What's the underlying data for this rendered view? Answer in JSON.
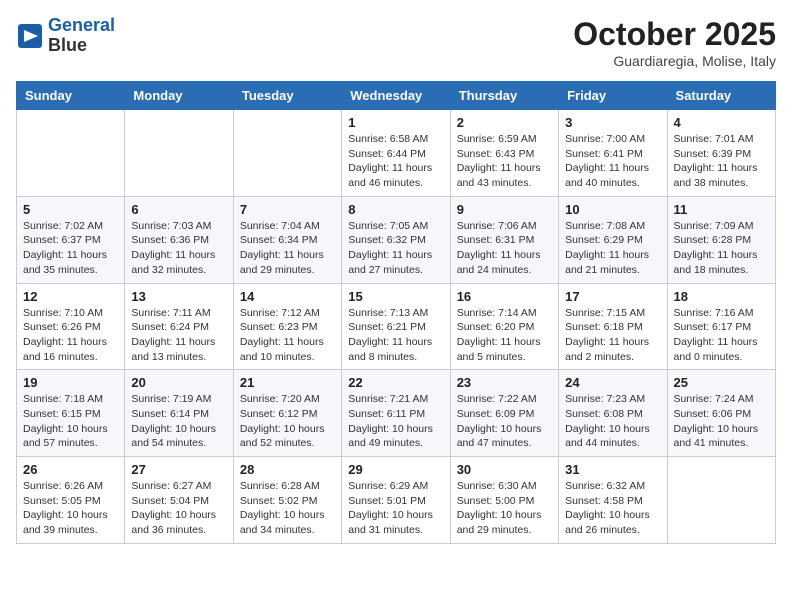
{
  "header": {
    "logo_line1": "General",
    "logo_line2": "Blue",
    "month": "October 2025",
    "location": "Guardiaregia, Molise, Italy"
  },
  "weekdays": [
    "Sunday",
    "Monday",
    "Tuesday",
    "Wednesday",
    "Thursday",
    "Friday",
    "Saturday"
  ],
  "weeks": [
    [
      {
        "day": "",
        "info": ""
      },
      {
        "day": "",
        "info": ""
      },
      {
        "day": "",
        "info": ""
      },
      {
        "day": "1",
        "info": "Sunrise: 6:58 AM\nSunset: 6:44 PM\nDaylight: 11 hours\nand 46 minutes."
      },
      {
        "day": "2",
        "info": "Sunrise: 6:59 AM\nSunset: 6:43 PM\nDaylight: 11 hours\nand 43 minutes."
      },
      {
        "day": "3",
        "info": "Sunrise: 7:00 AM\nSunset: 6:41 PM\nDaylight: 11 hours\nand 40 minutes."
      },
      {
        "day": "4",
        "info": "Sunrise: 7:01 AM\nSunset: 6:39 PM\nDaylight: 11 hours\nand 38 minutes."
      }
    ],
    [
      {
        "day": "5",
        "info": "Sunrise: 7:02 AM\nSunset: 6:37 PM\nDaylight: 11 hours\nand 35 minutes."
      },
      {
        "day": "6",
        "info": "Sunrise: 7:03 AM\nSunset: 6:36 PM\nDaylight: 11 hours\nand 32 minutes."
      },
      {
        "day": "7",
        "info": "Sunrise: 7:04 AM\nSunset: 6:34 PM\nDaylight: 11 hours\nand 29 minutes."
      },
      {
        "day": "8",
        "info": "Sunrise: 7:05 AM\nSunset: 6:32 PM\nDaylight: 11 hours\nand 27 minutes."
      },
      {
        "day": "9",
        "info": "Sunrise: 7:06 AM\nSunset: 6:31 PM\nDaylight: 11 hours\nand 24 minutes."
      },
      {
        "day": "10",
        "info": "Sunrise: 7:08 AM\nSunset: 6:29 PM\nDaylight: 11 hours\nand 21 minutes."
      },
      {
        "day": "11",
        "info": "Sunrise: 7:09 AM\nSunset: 6:28 PM\nDaylight: 11 hours\nand 18 minutes."
      }
    ],
    [
      {
        "day": "12",
        "info": "Sunrise: 7:10 AM\nSunset: 6:26 PM\nDaylight: 11 hours\nand 16 minutes."
      },
      {
        "day": "13",
        "info": "Sunrise: 7:11 AM\nSunset: 6:24 PM\nDaylight: 11 hours\nand 13 minutes."
      },
      {
        "day": "14",
        "info": "Sunrise: 7:12 AM\nSunset: 6:23 PM\nDaylight: 11 hours\nand 10 minutes."
      },
      {
        "day": "15",
        "info": "Sunrise: 7:13 AM\nSunset: 6:21 PM\nDaylight: 11 hours\nand 8 minutes."
      },
      {
        "day": "16",
        "info": "Sunrise: 7:14 AM\nSunset: 6:20 PM\nDaylight: 11 hours\nand 5 minutes."
      },
      {
        "day": "17",
        "info": "Sunrise: 7:15 AM\nSunset: 6:18 PM\nDaylight: 11 hours\nand 2 minutes."
      },
      {
        "day": "18",
        "info": "Sunrise: 7:16 AM\nSunset: 6:17 PM\nDaylight: 11 hours\nand 0 minutes."
      }
    ],
    [
      {
        "day": "19",
        "info": "Sunrise: 7:18 AM\nSunset: 6:15 PM\nDaylight: 10 hours\nand 57 minutes."
      },
      {
        "day": "20",
        "info": "Sunrise: 7:19 AM\nSunset: 6:14 PM\nDaylight: 10 hours\nand 54 minutes."
      },
      {
        "day": "21",
        "info": "Sunrise: 7:20 AM\nSunset: 6:12 PM\nDaylight: 10 hours\nand 52 minutes."
      },
      {
        "day": "22",
        "info": "Sunrise: 7:21 AM\nSunset: 6:11 PM\nDaylight: 10 hours\nand 49 minutes."
      },
      {
        "day": "23",
        "info": "Sunrise: 7:22 AM\nSunset: 6:09 PM\nDaylight: 10 hours\nand 47 minutes."
      },
      {
        "day": "24",
        "info": "Sunrise: 7:23 AM\nSunset: 6:08 PM\nDaylight: 10 hours\nand 44 minutes."
      },
      {
        "day": "25",
        "info": "Sunrise: 7:24 AM\nSunset: 6:06 PM\nDaylight: 10 hours\nand 41 minutes."
      }
    ],
    [
      {
        "day": "26",
        "info": "Sunrise: 6:26 AM\nSunset: 5:05 PM\nDaylight: 10 hours\nand 39 minutes."
      },
      {
        "day": "27",
        "info": "Sunrise: 6:27 AM\nSunset: 5:04 PM\nDaylight: 10 hours\nand 36 minutes."
      },
      {
        "day": "28",
        "info": "Sunrise: 6:28 AM\nSunset: 5:02 PM\nDaylight: 10 hours\nand 34 minutes."
      },
      {
        "day": "29",
        "info": "Sunrise: 6:29 AM\nSunset: 5:01 PM\nDaylight: 10 hours\nand 31 minutes."
      },
      {
        "day": "30",
        "info": "Sunrise: 6:30 AM\nSunset: 5:00 PM\nDaylight: 10 hours\nand 29 minutes."
      },
      {
        "day": "31",
        "info": "Sunrise: 6:32 AM\nSunset: 4:58 PM\nDaylight: 10 hours\nand 26 minutes."
      },
      {
        "day": "",
        "info": ""
      }
    ]
  ]
}
